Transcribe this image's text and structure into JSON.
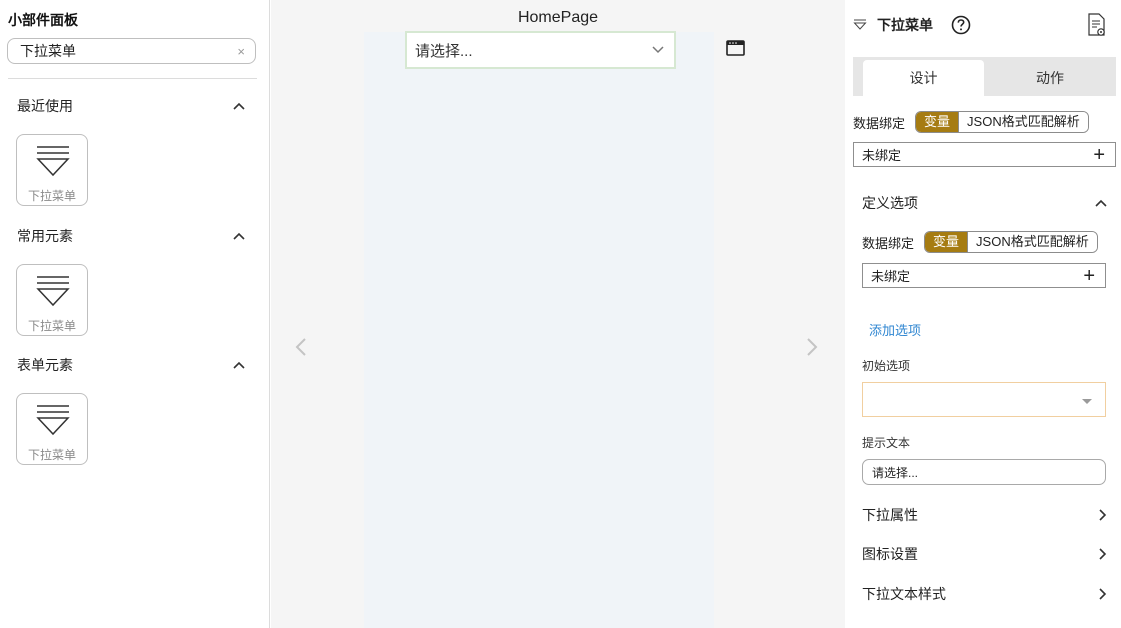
{
  "widget_panel": {
    "title": "小部件面板",
    "search": {
      "value": "下拉菜单",
      "clear": "×"
    },
    "sections": [
      {
        "title": "最近使用",
        "item_label": "下拉菜单"
      },
      {
        "title": "常用元素",
        "item_label": "下拉菜单"
      },
      {
        "title": "表单元素",
        "item_label": "下拉菜单"
      }
    ]
  },
  "canvas": {
    "page_title": "HomePage",
    "dropdown_placeholder": "请选择..."
  },
  "properties": {
    "component_name": "下拉菜单",
    "tabs": [
      "设计",
      "动作"
    ],
    "binding_label": "数据绑定",
    "binding_modes": [
      "变量",
      "JSON格式匹配解析"
    ],
    "unbound_text": "未绑定",
    "plus": "+",
    "options_section": "定义选项",
    "add_option": "添加选项",
    "initial_option_label": "初始选项",
    "hint_text_label": "提示文本",
    "hint_text_value": "请选择...",
    "collapsed_sections": [
      "下拉属性",
      "图标设置",
      "下拉文本样式"
    ]
  },
  "colors": {
    "accent": "#a67c12",
    "link": "#2f86d1",
    "canvas_bg": "#f0f4f8"
  }
}
